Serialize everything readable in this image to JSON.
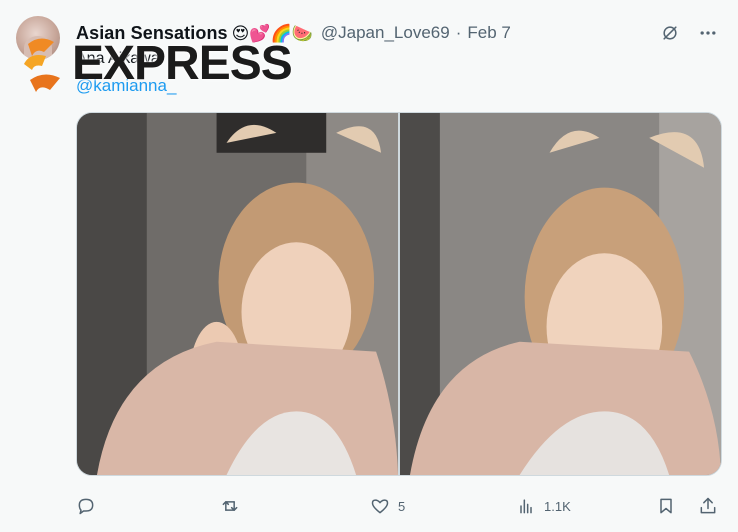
{
  "tweet": {
    "display_name": "Asian Sensations",
    "emojis": "😍💕🌈🍉",
    "handle": "@Japan_Love69",
    "separator": "·",
    "date": "Feb 7",
    "text": "Ana Aikawa",
    "mention": "@kamianna_",
    "media": [
      {
        "alt": "photo-left",
        "desc_icon": "photo"
      },
      {
        "alt": "photo-right",
        "desc_icon": "photo"
      }
    ],
    "stats": {
      "likes": "5",
      "views": "1.1K"
    }
  },
  "watermark": {
    "text": "EXPRESS"
  },
  "icons": {
    "grok": "grok-icon",
    "more": "more-icon",
    "reply": "reply-icon",
    "repost": "repost-icon",
    "like": "heart-icon",
    "views": "analytics-icon",
    "bookmark": "bookmark-icon",
    "share": "share-icon"
  },
  "colors": {
    "text": "#0f1419",
    "secondary": "#536471",
    "link": "#1d9bf0",
    "background": "#f7f9f9"
  }
}
